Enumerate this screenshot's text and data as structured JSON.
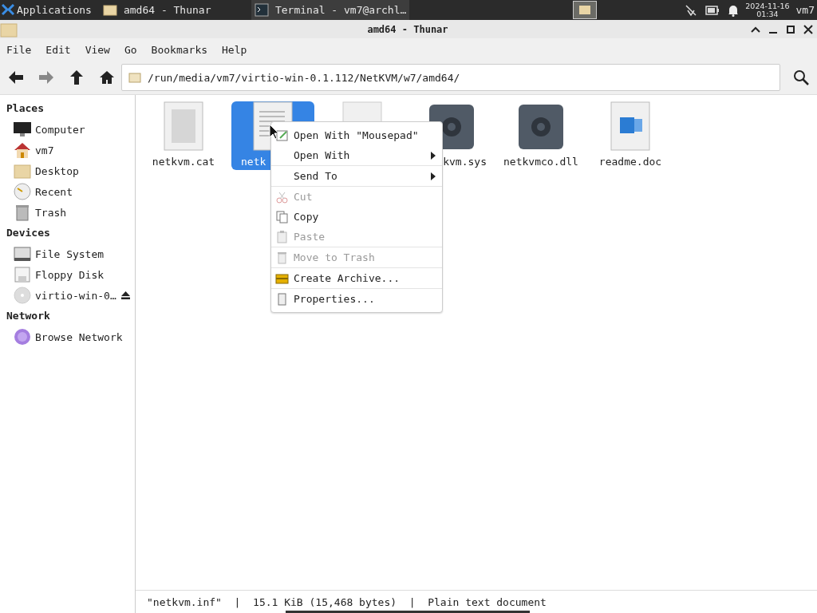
{
  "panel": {
    "apps_menu": "Applications",
    "tasks": [
      {
        "label": "amd64 - Thunar",
        "kind": "folder",
        "selected": false
      },
      {
        "label": "Terminal - vm7@archl…",
        "kind": "terminal",
        "selected": true
      }
    ],
    "clock": {
      "date": "2024-11-16",
      "time": "01:34"
    },
    "user": "vm7"
  },
  "window": {
    "title": "amd64 - Thunar"
  },
  "menubar": [
    "File",
    "Edit",
    "View",
    "Go",
    "Bookmarks",
    "Help"
  ],
  "location": {
    "path": "/run/media/vm7/virtio-win-0.1.112/NetKVM/w7/amd64/"
  },
  "sidebar": [
    {
      "heading": "Places",
      "items": [
        {
          "label": "Computer",
          "kind": "computer"
        },
        {
          "label": "vm7",
          "kind": "home"
        },
        {
          "label": "Desktop",
          "kind": "folder"
        },
        {
          "label": "Recent",
          "kind": "recent"
        },
        {
          "label": "Trash",
          "kind": "trash"
        }
      ]
    },
    {
      "heading": "Devices",
      "items": [
        {
          "label": "File System",
          "kind": "drive"
        },
        {
          "label": "Floppy Disk",
          "kind": "floppy"
        },
        {
          "label": "virtio-win-0…",
          "kind": "disc",
          "ejectable": true
        }
      ]
    },
    {
      "heading": "Network",
      "items": [
        {
          "label": "Browse Network",
          "kind": "network"
        }
      ]
    }
  ],
  "files": [
    {
      "label": "netkvm.cat",
      "kind": "catalog",
      "selected": false
    },
    {
      "label": "netk",
      "kind": "text",
      "selected": true,
      "clipped_right": true
    },
    {
      "kind": "blank",
      "selected": false
    },
    {
      "label": "kvm.sys",
      "kind": "gear",
      "selected": false,
      "clipped_left": true
    },
    {
      "label": "netkvmco.dll",
      "kind": "gear",
      "selected": false
    },
    {
      "label": "readme.doc",
      "kind": "word",
      "selected": false
    }
  ],
  "context_menu": [
    [
      {
        "label": "Open With \"Mousepad\"",
        "kind": "editor",
        "disabled": false
      },
      {
        "label": "Open With",
        "submenu": true,
        "disabled": false
      }
    ],
    [
      {
        "label": "Send To",
        "submenu": true,
        "disabled": false
      }
    ],
    [
      {
        "label": "Cut",
        "kind": "cut",
        "disabled": true
      },
      {
        "label": "Copy",
        "kind": "copy",
        "disabled": false
      },
      {
        "label": "Paste",
        "kind": "paste",
        "disabled": true
      }
    ],
    [
      {
        "label": "Move to Trash",
        "kind": "trash",
        "disabled": true
      }
    ],
    [
      {
        "label": "Create Archive...",
        "kind": "archive",
        "disabled": false
      }
    ],
    [
      {
        "label": "Properties...",
        "kind": "properties",
        "disabled": false
      }
    ]
  ],
  "status_bar": {
    "parts": [
      "\"netkvm.inf\"",
      "|",
      "15.1 KiB (15,468 bytes)",
      "|",
      "Plain text document"
    ]
  }
}
